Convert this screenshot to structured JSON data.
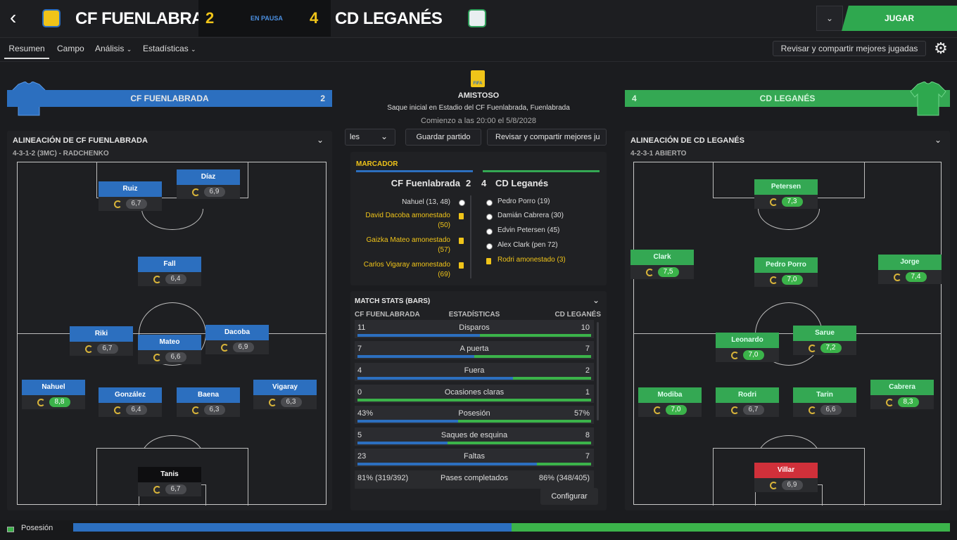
{
  "header": {
    "home": "CF FUENLABRADA",
    "away": "CD LEGANÉS",
    "home_score": "2",
    "away_score": "4",
    "status": "EN PAUSA",
    "play": "JUGAR"
  },
  "nav": {
    "tabs": [
      "Resumen",
      "Campo",
      "Análisis",
      "Estadísticas"
    ],
    "share": "Revisar y compartir mejores jugadas"
  },
  "match": {
    "competition": "AMISTOSO",
    "venue": "Saque inicial en Estadio del CF Fuenlabrada, Fuenlabrada",
    "kickoff": "Comienzo a las 20:00 el 5/8/2028",
    "btn_left": "les",
    "btn_save": "Guardar partido",
    "btn_share": "Revisar y compartir mejores ju"
  },
  "home_bar": {
    "name": "CF FUENLABRADA",
    "score": "2"
  },
  "away_bar": {
    "name": "CD LEGANÉS",
    "score": "4"
  },
  "home_lineup": {
    "title": "ALINEACIÓN DE CF FUENLABRADA",
    "formation": "4-3-1-2 (3MC) - RADCHENKO"
  },
  "away_lineup": {
    "title": "ALINEACIÓN DE CD LEGANÉS",
    "formation": "4-2-3-1 ABIERTO"
  },
  "home_players": [
    {
      "name": "Díaz",
      "rating": "6,9",
      "good": false
    },
    {
      "name": "Ruiz",
      "rating": "6,7",
      "good": false
    },
    {
      "name": "Fall",
      "rating": "6,4",
      "good": false
    },
    {
      "name": "Riki",
      "rating": "6,7",
      "good": false
    },
    {
      "name": "Mateo",
      "rating": "6,6",
      "good": false
    },
    {
      "name": "Dacoba",
      "rating": "6,9",
      "good": false
    },
    {
      "name": "Nahuel",
      "rating": "8,8",
      "good": true
    },
    {
      "name": "González",
      "rating": "6,4",
      "good": false
    },
    {
      "name": "Baena",
      "rating": "6,3",
      "good": false
    },
    {
      "name": "Vigaray",
      "rating": "6,3",
      "good": false
    },
    {
      "name": "Tanis",
      "rating": "6,7",
      "good": false
    }
  ],
  "away_players": [
    {
      "name": "Petersen",
      "rating": "7,3",
      "good": true
    },
    {
      "name": "Clark",
      "rating": "7,5",
      "good": true
    },
    {
      "name": "Pedro Porro",
      "rating": "7,0",
      "good": true
    },
    {
      "name": "Jorge",
      "rating": "7,4",
      "good": true
    },
    {
      "name": "Leonardo",
      "rating": "7,0",
      "good": true
    },
    {
      "name": "Sarue",
      "rating": "7,2",
      "good": true
    },
    {
      "name": "Modiba",
      "rating": "7,0",
      "good": true
    },
    {
      "name": "Rodri",
      "rating": "6,7",
      "good": false
    },
    {
      "name": "Tarin",
      "rating": "6,6",
      "good": false
    },
    {
      "name": "Cabrera",
      "rating": "8,3",
      "good": true
    },
    {
      "name": "Villar",
      "rating": "6,9",
      "good": false
    }
  ],
  "scoreboard": {
    "label": "MARCADOR",
    "home": "CF Fuenlabrada",
    "home_score": "2",
    "away_score": "4",
    "away": "CD Leganés",
    "home_events": [
      {
        "text": "Nahuel (13, 48)",
        "type": "goal"
      },
      {
        "text": "David Dacoba amonestado (50)",
        "type": "card"
      },
      {
        "text": "Gaizka Mateo amonestado (57)",
        "type": "card"
      },
      {
        "text": "Carlos Vigaray amonestado (69)",
        "type": "card"
      }
    ],
    "away_events": [
      {
        "text": "Pedro Porro (19)",
        "type": "goal"
      },
      {
        "text": "Damián Cabrera (30)",
        "type": "goal"
      },
      {
        "text": "Edvin Petersen (45)",
        "type": "goal"
      },
      {
        "text": "Alex Clark (pen 72)",
        "type": "goal"
      },
      {
        "text": "Rodri amonestado (3)",
        "type": "card"
      }
    ]
  },
  "stats": {
    "title": "MATCH STATS (BARS)",
    "col_home": "CF FUENLABRADA",
    "col_mid": "ESTADÍSTICAS",
    "col_away": "CD LEGANÉS",
    "configure": "Configurar",
    "rows": [
      {
        "home": "11",
        "label": "Disparos",
        "away": "10",
        "home_share": 0.524
      },
      {
        "home": "7",
        "label": "A puerta",
        "away": "7",
        "home_share": 0.5
      },
      {
        "home": "4",
        "label": "Fuera",
        "away": "2",
        "home_share": 0.667
      },
      {
        "home": "0",
        "label": "Ocasiones claras",
        "away": "1",
        "home_share": 0.0
      },
      {
        "home": "43%",
        "label": "Posesión",
        "away": "57%",
        "home_share": 0.43
      },
      {
        "home": "5",
        "label": "Saques de esquina",
        "away": "8",
        "home_share": 0.385
      },
      {
        "home": "23",
        "label": "Faltas",
        "away": "7",
        "home_share": 0.767
      },
      {
        "home": "81% (319/392)",
        "label": "Pases completados",
        "away": "86% (348/405)",
        "home_share": null
      }
    ]
  },
  "possession": {
    "label": "Posesión",
    "home_share": 0.5
  },
  "colors": {
    "home": "#2c6fbf",
    "away": "#34a853",
    "gold": "#f0c419"
  }
}
